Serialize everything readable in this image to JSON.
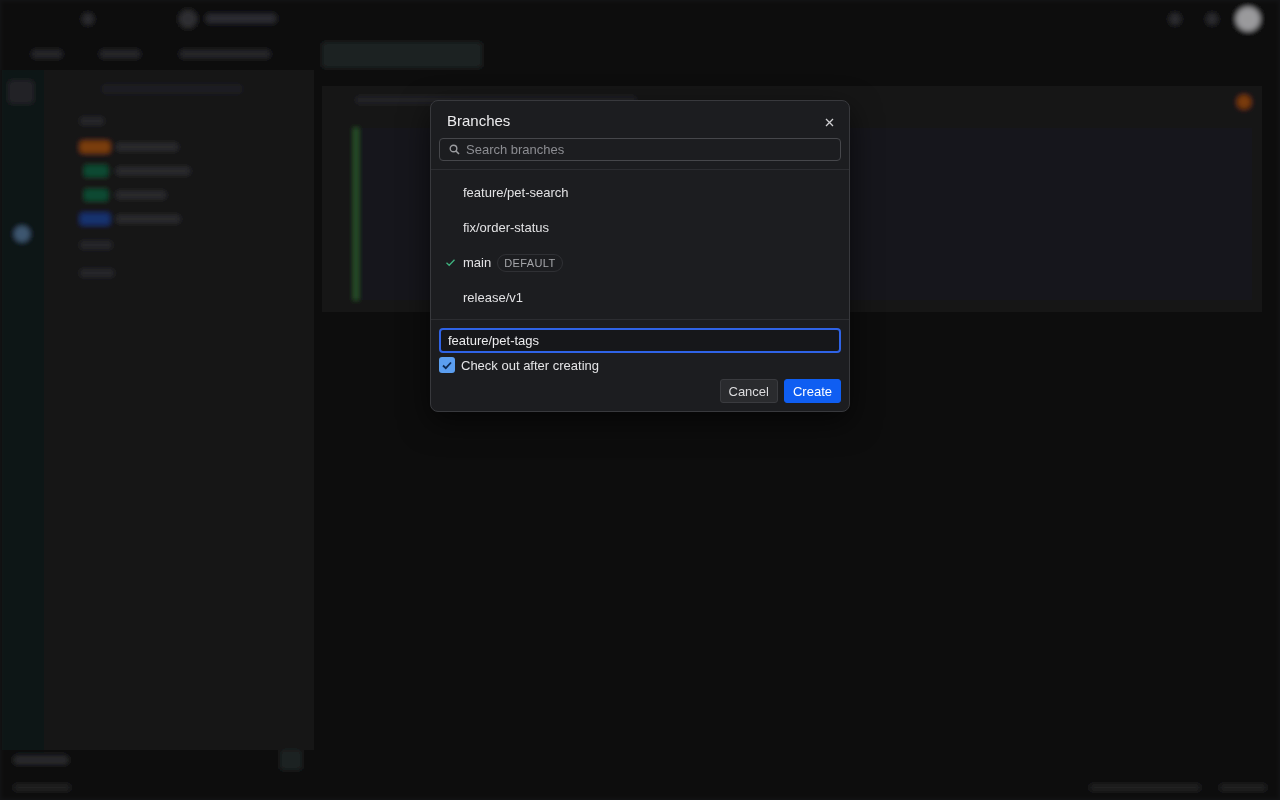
{
  "dialog": {
    "title": "Branches",
    "search": {
      "placeholder": "Search branches"
    },
    "branches": [
      {
        "name": "feature/pet-search",
        "checked": false
      },
      {
        "name": "fix/order-status",
        "checked": false
      },
      {
        "name": "main",
        "checked": true,
        "badge": "DEFAULT"
      },
      {
        "name": "release/v1",
        "checked": false
      }
    ],
    "new_branch": {
      "value": "feature/pet-tags"
    },
    "checkout": {
      "label": "Check out after creating",
      "checked": true
    },
    "buttons": [
      {
        "label": "Cancel",
        "kind": "secondary"
      },
      {
        "label": "Create",
        "kind": "primary"
      }
    ]
  }
}
